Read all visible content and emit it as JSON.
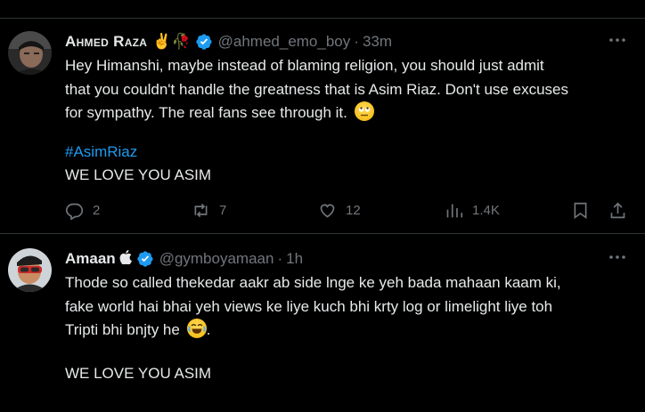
{
  "tweets": [
    {
      "author_name": "Ahmed Raza",
      "author_emojis": "✌🥀",
      "handle": "@ahmed_emo_boy",
      "separator": "·",
      "time": "33m",
      "text_line_1": "Hey Himanshi, maybe instead of blaming religion, you should just admit",
      "text_line_2": "that you couldn't handle the greatness that is Asim Riaz. Don't use excuses",
      "text_line_3": "for sympathy. The real fans see through it.",
      "text_emoji": "🙄",
      "hashtag": "#AsimRiaz",
      "closing": "WE LOVE YOU ASIM",
      "replies": "2",
      "reposts": "7",
      "likes": "12",
      "views": "1.4K"
    },
    {
      "author_name": "Amaan",
      "author_emojis": "",
      "handle": "@gymboyamaan",
      "separator": "·",
      "time": "1h",
      "text_line_1": "Thode so called thekedar aakr ab side lnge ke yeh bada mahaan kaam ki,",
      "text_line_2": "fake world hai bhai yeh views ke liye kuch bhi krty log or limelight liye toh",
      "text_line_3": "Tripti bhi bnjty he",
      "text_emoji": "😂",
      "text_end": ".",
      "closing": "WE LOVE YOU ASIM"
    }
  ],
  "icons": {
    "more": "more-dots-icon",
    "verified": "verified-badge-icon",
    "reply": "reply-icon",
    "repost": "repost-icon",
    "like": "like-icon",
    "views": "views-icon",
    "bookmark": "bookmark-icon",
    "share": "share-icon",
    "apple": "apple-icon"
  },
  "colors": {
    "background": "#000000",
    "text": "#e7e9ea",
    "muted": "#71767b",
    "accent": "#1d9bf0",
    "divider": "#2f3336"
  }
}
